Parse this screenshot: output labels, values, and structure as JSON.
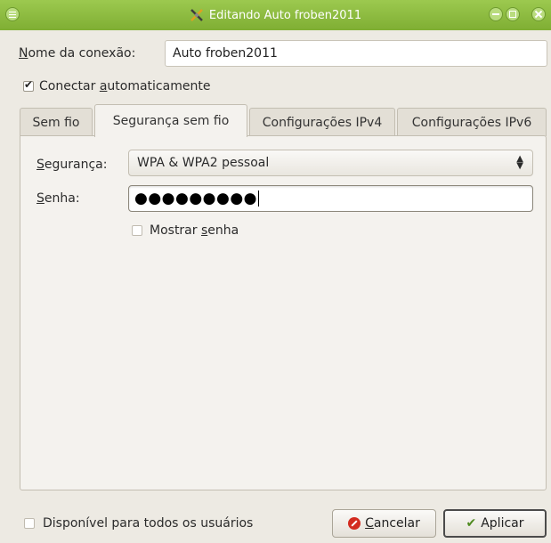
{
  "window": {
    "title": "Editando Auto froben2011",
    "accent": "#8bbd3f"
  },
  "connection": {
    "name_label_pre": "",
    "name_label_mnemonic": "N",
    "name_label_post": "ome da conexão:",
    "name_value": "Auto froben2011",
    "auto_connect_pre": "Conectar ",
    "auto_connect_mnemonic": "a",
    "auto_connect_post": "utomaticamente",
    "auto_connect_checked": true
  },
  "tabs": [
    {
      "label": "Sem fio",
      "active": false
    },
    {
      "label": "Segurança sem fio",
      "active": true
    },
    {
      "label": "Configurações IPv4",
      "active": false
    },
    {
      "label": "Configurações IPv6",
      "active": false
    }
  ],
  "security": {
    "label_mnemonic": "S",
    "label_post": "egurança:",
    "selected": "WPA & WPA2 pessoal"
  },
  "password": {
    "label_mnemonic": "S",
    "label_post": "enha:",
    "masked_value": "●●●●●●●●●",
    "show_pre": "Mostrar ",
    "show_mnemonic": "s",
    "show_post": "enha",
    "show_checked": false
  },
  "footer": {
    "available_all": "Disponível para todos os usuários",
    "available_checked": false,
    "cancel_mnemonic": "C",
    "cancel_post": "ancelar",
    "apply": "Aplicar"
  },
  "icons": {
    "window_menu": "window-menu-icon",
    "app": "network-tool-icon",
    "cancel": "cancel-icon",
    "apply": "checkmark-icon"
  }
}
